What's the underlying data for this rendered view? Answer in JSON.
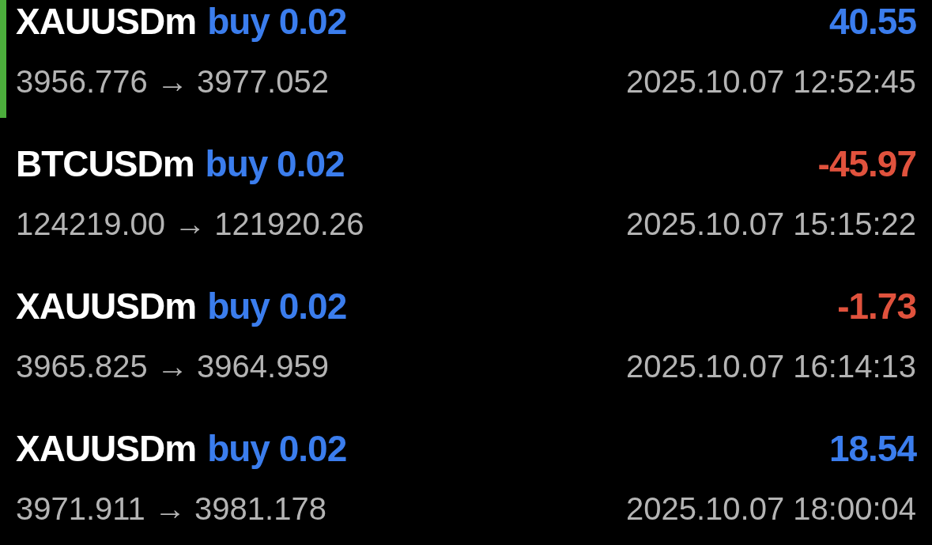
{
  "trades": [
    {
      "symbol": "XAUUSDm",
      "side": "buy 0.02",
      "profit": "40.55",
      "color": "#3b7ded",
      "prices": "3956.776 → 3977.052",
      "time": "2025.10.07 12:52:45",
      "selected": true
    },
    {
      "symbol": "BTCUSDm",
      "side": "buy 0.02",
      "profit": "-45.97",
      "color": "#e0523d",
      "prices": "124219.00 → 121920.26",
      "time": "2025.10.07 15:15:22",
      "selected": false
    },
    {
      "symbol": "XAUUSDm",
      "side": "buy 0.02",
      "profit": "-1.73",
      "color": "#e0523d",
      "prices": "3965.825 → 3964.959",
      "time": "2025.10.07 16:14:13",
      "selected": false
    },
    {
      "symbol": "XAUUSDm",
      "side": "buy 0.02",
      "profit": "18.54",
      "color": "#3b7ded",
      "prices": "3971.911 → 3981.178",
      "time": "2025.10.07 18:00:04",
      "selected": false
    }
  ]
}
